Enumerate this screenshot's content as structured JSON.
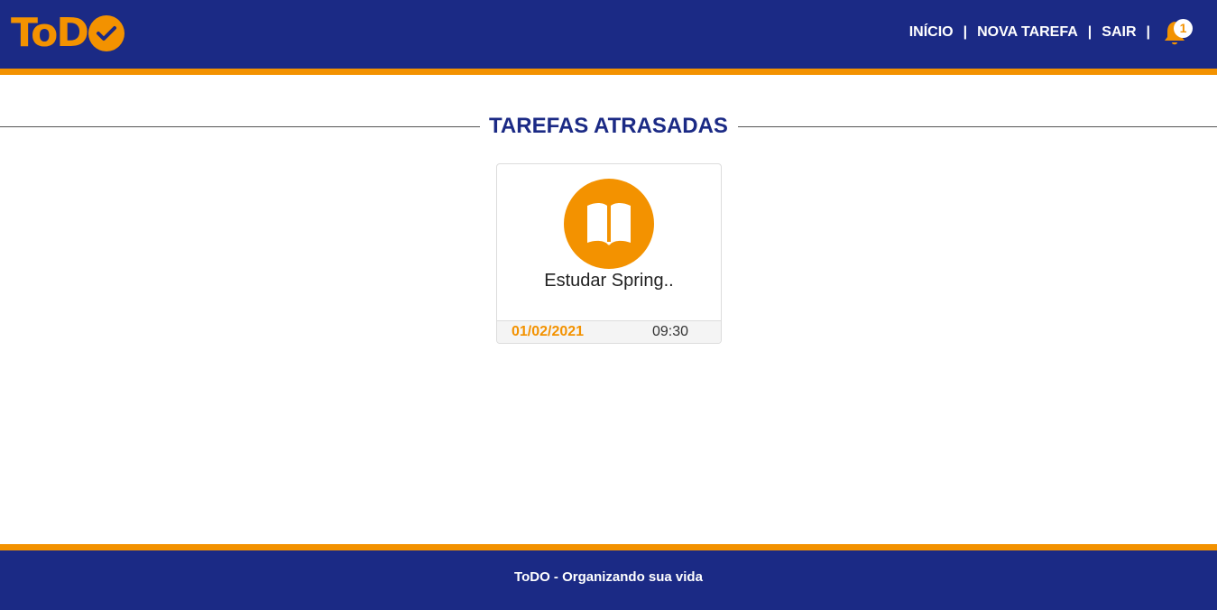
{
  "colors": {
    "primary": "#1b2a85",
    "accent": "#f39200",
    "background": "#ffffff"
  },
  "header": {
    "logo_text": "ToD",
    "logo_icon": "check-circle-icon",
    "nav": {
      "home_label": "INÍCIO",
      "new_task_label": "NOVA TAREFA",
      "logout_label": "SAIR",
      "separator": "|"
    },
    "notifications": {
      "icon": "bell-icon",
      "count": "1"
    }
  },
  "main": {
    "section_title": "TAREFAS ATRASADAS",
    "tasks": [
      {
        "icon": "book-icon",
        "title": "Estudar Spring..",
        "date": "01/02/2021",
        "time": "09:30"
      }
    ]
  },
  "footer": {
    "text": "ToDO - Organizando sua vida"
  }
}
